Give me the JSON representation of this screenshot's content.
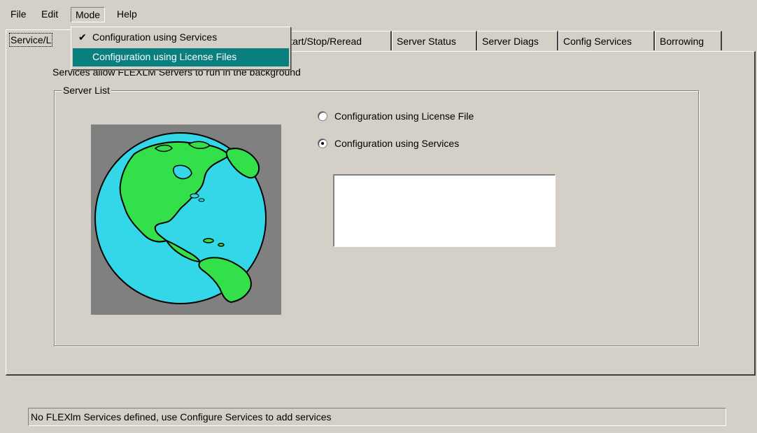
{
  "menubar": {
    "items": [
      "File",
      "Edit",
      "Mode",
      "Help"
    ],
    "open_menu": "Mode"
  },
  "mode_menu": {
    "items": [
      {
        "label": "Configuration using Services",
        "checked": true,
        "highlighted": false
      },
      {
        "label": "Configuration using License Files",
        "checked": false,
        "highlighted": true
      }
    ],
    "check_glyph": "✔"
  },
  "tabs": {
    "items": [
      "Service/L",
      "Start/Stop/Reread",
      "Server Status",
      "Server Diags",
      "Config Services",
      "Borrowing"
    ],
    "active_index": 0
  },
  "service_tab": {
    "description": "Services allow FLEXLM Servers to run in the background",
    "group_label": "Server List",
    "globe_icon": "earth-globe-icon",
    "radios": [
      {
        "label": "Configuration using License File",
        "checked": false
      },
      {
        "label": "Configuration using Services",
        "checked": true
      }
    ],
    "server_list_items": []
  },
  "status_bar": {
    "text": "No FLEXlm Services defined, use Configure Services to add services"
  },
  "colors": {
    "window_bg": "#d4d0c8",
    "menu_highlight": "#0a7f7f",
    "globe_ocean": "#33d7e7",
    "globe_land": "#33e04a",
    "globe_bg": "#808080"
  }
}
